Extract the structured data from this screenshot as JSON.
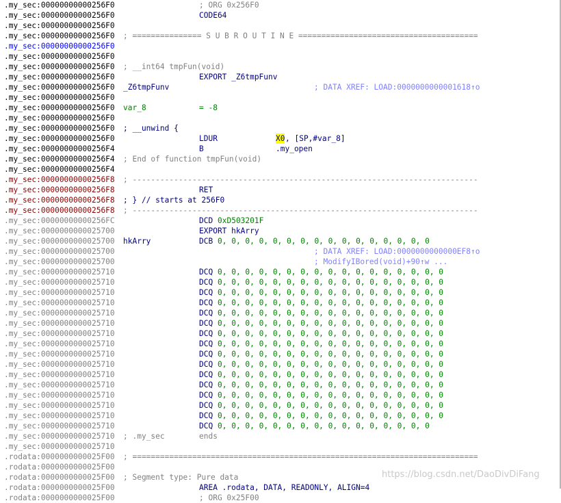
{
  "colors": {
    "address": "#000000",
    "address_blue": "#0000ff",
    "address_red": "#8b0000",
    "address_gray": "#808080",
    "comment": "#808080",
    "xref": "#8080ff",
    "code": "#000080",
    "number": "#008000",
    "highlight": "#ffff00"
  },
  "watermark": "https://blog.csdn.net/DaoDivDiFang",
  "lines": [
    {
      "addr": ".my_sec:00000000000256F0",
      "ac": "address",
      "cols": [
        {
          "x": "c291",
          "t": "; ORG 0x256F0",
          "c": "comment"
        }
      ]
    },
    {
      "addr": ".my_sec:00000000000256F0",
      "ac": "address",
      "cols": [
        {
          "x": "c291",
          "t": "CODE64",
          "c": "code"
        }
      ]
    },
    {
      "addr": ".my_sec:00000000000256F0",
      "ac": "address",
      "cols": []
    },
    {
      "addr": ".my_sec:00000000000256F0",
      "ac": "address",
      "cols": [
        {
          "x": "c180",
          "t": "; =============== S U B R O U T I N E =======================================",
          "c": "comment"
        }
      ]
    },
    {
      "addr": ".my_sec:00000000000256F0",
      "ac": "address_blue",
      "cols": []
    },
    {
      "addr": ".my_sec:00000000000256F0",
      "ac": "address",
      "cols": []
    },
    {
      "addr": ".my_sec:00000000000256F0",
      "ac": "address",
      "cols": [
        {
          "x": "c180",
          "t": "; __int64 tmpFun(void)",
          "c": "comment"
        }
      ]
    },
    {
      "addr": ".my_sec:00000000000256F0",
      "ac": "address",
      "cols": [
        {
          "x": "c291",
          "t": "EXPORT _Z6tmpFunv",
          "c": "code"
        }
      ]
    },
    {
      "addr": ".my_sec:00000000000256F0",
      "ac": "address",
      "cols": [
        {
          "x": "c180",
          "t": "_Z6tmpFunv",
          "c": "code"
        },
        {
          "x": "c459",
          "t": "; DATA XREF: LOAD:0000000000001618↑o",
          "c": "xref"
        }
      ]
    },
    {
      "addr": ".my_sec:00000000000256F0",
      "ac": "address",
      "cols": []
    },
    {
      "addr": ".my_sec:00000000000256F0",
      "ac": "address",
      "cols": [
        {
          "x": "c180",
          "t": "var_8",
          "c": "number"
        },
        {
          "x": "c291",
          "t": "= -8",
          "c": "number"
        }
      ]
    },
    {
      "addr": ".my_sec:00000000000256F0",
      "ac": "address",
      "cols": []
    },
    {
      "addr": ".my_sec:00000000000256F0",
      "ac": "address",
      "cols": [
        {
          "x": "c180",
          "t": "; __unwind {",
          "c": "code"
        }
      ]
    },
    {
      "addr": ".my_sec:00000000000256F0",
      "ac": "address",
      "cols": [
        {
          "x": "c291",
          "t": "LDUR",
          "c": "code"
        },
        {
          "x": "c403",
          "t": "X0",
          "c": "code",
          "hl": true
        },
        {
          "x": "c417",
          "t": ", [SP,#var_8]",
          "c": "code"
        }
      ]
    },
    {
      "addr": ".my_sec:00000000000256F4",
      "ac": "address",
      "cols": [
        {
          "x": "c291",
          "t": "B",
          "c": "code"
        },
        {
          "x": "c403",
          "t": ".my_open",
          "c": "code"
        }
      ]
    },
    {
      "addr": ".my_sec:00000000000256F4",
      "ac": "address",
      "cols": [
        {
          "x": "c180",
          "t": "; End of function tmpFun(void)",
          "c": "comment"
        }
      ]
    },
    {
      "addr": ".my_sec:00000000000256F4",
      "ac": "address",
      "cols": []
    },
    {
      "addr": ".my_sec:00000000000256F8",
      "ac": "address_red",
      "cols": [
        {
          "x": "c180",
          "t": "; ---------------------------------------------------------------------------",
          "c": "comment"
        }
      ]
    },
    {
      "addr": ".my_sec:00000000000256F8",
      "ac": "address_red",
      "cols": [
        {
          "x": "c291",
          "t": "RET",
          "c": "code"
        }
      ]
    },
    {
      "addr": ".my_sec:00000000000256F8",
      "ac": "address_red",
      "cols": [
        {
          "x": "c180",
          "t": "; } // starts at 256F0",
          "c": "code"
        }
      ]
    },
    {
      "addr": ".my_sec:00000000000256F8",
      "ac": "address_red",
      "cols": [
        {
          "x": "c180",
          "t": "; ---------------------------------------------------------------------------",
          "c": "comment"
        }
      ]
    },
    {
      "addr": ".my_sec:00000000000256FC",
      "ac": "address_gray",
      "cols": [
        {
          "x": "c291",
          "t": "DCD ",
          "c": "code"
        },
        {
          "x": "c318",
          "t": "0xD503201F",
          "c": "number"
        }
      ]
    },
    {
      "addr": ".my_sec:0000000000025700",
      "ac": "address_gray",
      "cols": [
        {
          "x": "c291",
          "t": "EXPORT hkArry",
          "c": "code"
        }
      ]
    },
    {
      "addr": ".my_sec:0000000000025700",
      "ac": "address_gray",
      "cols": [
        {
          "x": "c180",
          "t": "hkArry",
          "c": "code"
        },
        {
          "x": "c291",
          "t": "DCB ",
          "c": "code"
        },
        {
          "x": "c318",
          "t": "0, 0, 0, 0, 0, 0, 0, 0, 0, 0, 0, 0, 0, 0, 0, 0",
          "c": "number"
        }
      ]
    },
    {
      "addr": ".my_sec:0000000000025700",
      "ac": "address_gray",
      "cols": [
        {
          "x": "c459",
          "t": "; DATA XREF: LOAD:0000000000000EF8↑o",
          "c": "xref"
        }
      ]
    },
    {
      "addr": ".my_sec:0000000000025700",
      "ac": "address_gray",
      "cols": [
        {
          "x": "c459",
          "t": "; ModifyIBored(void)+90↑w ...",
          "c": "xref"
        }
      ]
    },
    {
      "addr": ".my_sec:0000000000025710",
      "ac": "address_gray",
      "cols": [
        {
          "x": "c291",
          "t": "DCQ ",
          "c": "code"
        },
        {
          "x": "c318",
          "t": "0, 0, 0, 0, 0, 0, 0, 0, 0, 0, 0, 0, 0, 0, 0, 0, 0",
          "c": "number"
        }
      ]
    },
    {
      "addr": ".my_sec:0000000000025710",
      "ac": "address_gray",
      "cols": [
        {
          "x": "c291",
          "t": "DCQ ",
          "c": "code"
        },
        {
          "x": "c318",
          "t": "0, 0, 0, 0, 0, 0, 0, 0, 0, 0, 0, 0, 0, 0, 0, 0, 0",
          "c": "number"
        }
      ]
    },
    {
      "addr": ".my_sec:0000000000025710",
      "ac": "address_gray",
      "cols": [
        {
          "x": "c291",
          "t": "DCQ ",
          "c": "code"
        },
        {
          "x": "c318",
          "t": "0, 0, 0, 0, 0, 0, 0, 0, 0, 0, 0, 0, 0, 0, 0, 0, 0",
          "c": "number"
        }
      ]
    },
    {
      "addr": ".my_sec:0000000000025710",
      "ac": "address_gray",
      "cols": [
        {
          "x": "c291",
          "t": "DCQ ",
          "c": "code"
        },
        {
          "x": "c318",
          "t": "0, 0, 0, 0, 0, 0, 0, 0, 0, 0, 0, 0, 0, 0, 0, 0, 0",
          "c": "number"
        }
      ]
    },
    {
      "addr": ".my_sec:0000000000025710",
      "ac": "address_gray",
      "cols": [
        {
          "x": "c291",
          "t": "DCQ ",
          "c": "code"
        },
        {
          "x": "c318",
          "t": "0, 0, 0, 0, 0, 0, 0, 0, 0, 0, 0, 0, 0, 0, 0, 0, 0",
          "c": "number"
        }
      ]
    },
    {
      "addr": ".my_sec:0000000000025710",
      "ac": "address_gray",
      "cols": [
        {
          "x": "c291",
          "t": "DCQ ",
          "c": "code"
        },
        {
          "x": "c318",
          "t": "0, 0, 0, 0, 0, 0, 0, 0, 0, 0, 0, 0, 0, 0, 0, 0, 0",
          "c": "number"
        }
      ]
    },
    {
      "addr": ".my_sec:0000000000025710",
      "ac": "address_gray",
      "cols": [
        {
          "x": "c291",
          "t": "DCQ ",
          "c": "code"
        },
        {
          "x": "c318",
          "t": "0, 0, 0, 0, 0, 0, 0, 0, 0, 0, 0, 0, 0, 0, 0, 0, 0",
          "c": "number"
        }
      ]
    },
    {
      "addr": ".my_sec:0000000000025710",
      "ac": "address_gray",
      "cols": [
        {
          "x": "c291",
          "t": "DCQ ",
          "c": "code"
        },
        {
          "x": "c318",
          "t": "0, 0, 0, 0, 0, 0, 0, 0, 0, 0, 0, 0, 0, 0, 0, 0, 0",
          "c": "number"
        }
      ]
    },
    {
      "addr": ".my_sec:0000000000025710",
      "ac": "address_gray",
      "cols": [
        {
          "x": "c291",
          "t": "DCQ ",
          "c": "code"
        },
        {
          "x": "c318",
          "t": "0, 0, 0, 0, 0, 0, 0, 0, 0, 0, 0, 0, 0, 0, 0, 0, 0",
          "c": "number"
        }
      ]
    },
    {
      "addr": ".my_sec:0000000000025710",
      "ac": "address_gray",
      "cols": [
        {
          "x": "c291",
          "t": "DCQ ",
          "c": "code"
        },
        {
          "x": "c318",
          "t": "0, 0, 0, 0, 0, 0, 0, 0, 0, 0, 0, 0, 0, 0, 0, 0, 0",
          "c": "number"
        }
      ]
    },
    {
      "addr": ".my_sec:0000000000025710",
      "ac": "address_gray",
      "cols": [
        {
          "x": "c291",
          "t": "DCQ ",
          "c": "code"
        },
        {
          "x": "c318",
          "t": "0, 0, 0, 0, 0, 0, 0, 0, 0, 0, 0, 0, 0, 0, 0, 0, 0",
          "c": "number"
        }
      ]
    },
    {
      "addr": ".my_sec:0000000000025710",
      "ac": "address_gray",
      "cols": [
        {
          "x": "c291",
          "t": "DCQ ",
          "c": "code"
        },
        {
          "x": "c318",
          "t": "0, 0, 0, 0, 0, 0, 0, 0, 0, 0, 0, 0, 0, 0, 0, 0, 0",
          "c": "number"
        }
      ]
    },
    {
      "addr": ".my_sec:0000000000025710",
      "ac": "address_gray",
      "cols": [
        {
          "x": "c291",
          "t": "DCQ ",
          "c": "code"
        },
        {
          "x": "c318",
          "t": "0, 0, 0, 0, 0, 0, 0, 0, 0, 0, 0, 0, 0, 0, 0, 0, 0",
          "c": "number"
        }
      ]
    },
    {
      "addr": ".my_sec:0000000000025710",
      "ac": "address_gray",
      "cols": [
        {
          "x": "c291",
          "t": "DCQ ",
          "c": "code"
        },
        {
          "x": "c318",
          "t": "0, 0, 0, 0, 0, 0, 0, 0, 0, 0, 0, 0, 0, 0, 0, 0, 0",
          "c": "number"
        }
      ]
    },
    {
      "addr": ".my_sec:0000000000025710",
      "ac": "address_gray",
      "cols": [
        {
          "x": "c291",
          "t": "DCQ ",
          "c": "code"
        },
        {
          "x": "c318",
          "t": "0, 0, 0, 0, 0, 0, 0, 0, 0, 0, 0, 0, 0, 0, 0, 0, 0",
          "c": "number"
        }
      ]
    },
    {
      "addr": ".my_sec:0000000000025710",
      "ac": "address_gray",
      "cols": [
        {
          "x": "c291",
          "t": "DCQ ",
          "c": "code"
        },
        {
          "x": "c318",
          "t": "0, 0, 0, 0, 0, 0, 0, 0, 0, 0, 0, 0, 0, 0, 0, 0",
          "c": "number"
        }
      ]
    },
    {
      "addr": ".my_sec:0000000000025710",
      "ac": "address_gray",
      "cols": [
        {
          "x": "c180",
          "t": "; .my_sec",
          "c": "comment"
        },
        {
          "x": "c291",
          "t": "ends",
          "c": "comment"
        }
      ]
    },
    {
      "addr": ".my_sec:0000000000025710",
      "ac": "address_gray",
      "cols": []
    },
    {
      "addr": ".rodata:0000000000025F00",
      "ac": "address_gray",
      "cols": [
        {
          "x": "c180",
          "t": "; ===========================================================================",
          "c": "comment"
        }
      ]
    },
    {
      "addr": ".rodata:0000000000025F00",
      "ac": "address_gray",
      "cols": []
    },
    {
      "addr": ".rodata:0000000000025F00",
      "ac": "address_gray",
      "cols": [
        {
          "x": "c180",
          "t": "; Segment type: Pure data",
          "c": "comment"
        }
      ]
    },
    {
      "addr": ".rodata:0000000000025F00",
      "ac": "address_gray",
      "cols": [
        {
          "x": "c291",
          "t": "AREA .rodata, DATA, READONLY, ALIGN=4",
          "c": "code"
        }
      ]
    },
    {
      "addr": ".rodata:0000000000025F00",
      "ac": "address_gray",
      "cols": [
        {
          "x": "c291",
          "t": "; ORG 0x25F00",
          "c": "comment"
        }
      ]
    }
  ]
}
